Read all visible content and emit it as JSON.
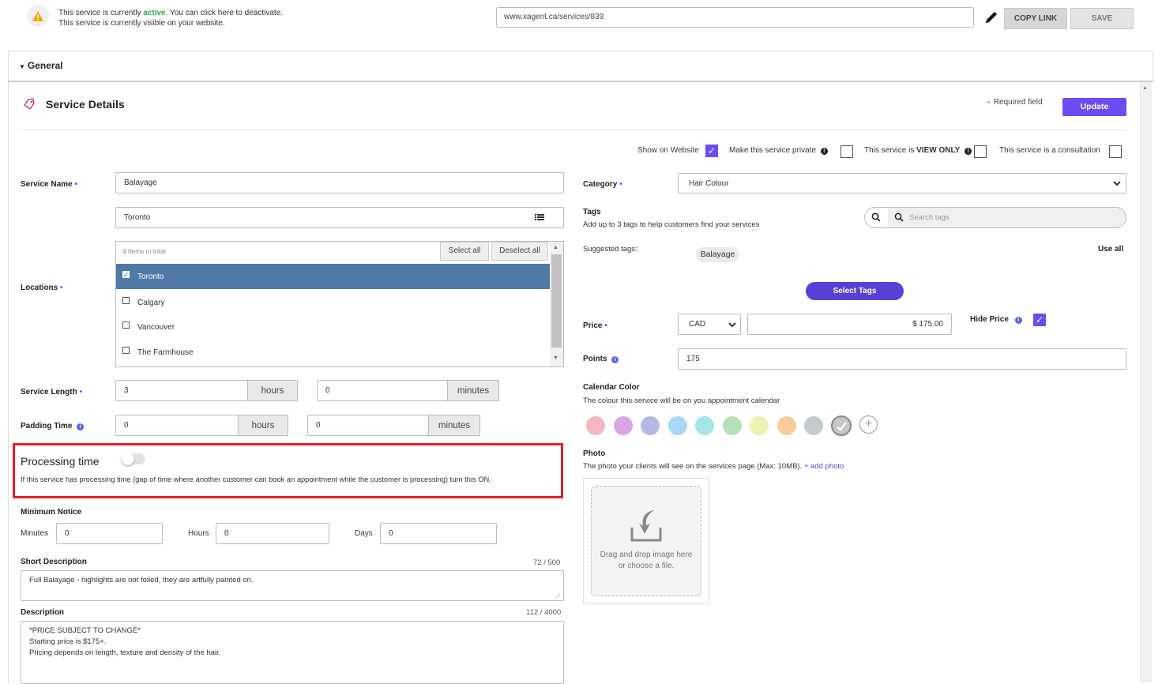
{
  "header": {
    "status_prefix": "This service is currently ",
    "status_word": "active",
    "status_suffix": ". You can click here to deactivate.",
    "visibility_line": "This service is currently visible on your website.",
    "url_value": "www.xagent.ca/services/839",
    "copy_link_label": "COPY LINK",
    "save_label": "SAVE"
  },
  "general": {
    "label": "General"
  },
  "details": {
    "title": "Service Details",
    "required_note": "Required field",
    "update_label": "Update",
    "flags": {
      "show_on_website": "Show on Website",
      "make_private": "Make this service private",
      "view_only_prefix": "This service is ",
      "view_only_bold": "VIEW ONLY",
      "consultation": "This service is a consultation"
    }
  },
  "form": {
    "service_name_label": "Service Name",
    "service_name_value": "Balayage",
    "location_selected": "Toronto",
    "locations_label": "Locations",
    "locations_total": "4 items in total",
    "select_all": "Select all",
    "deselect_all": "Deselect all",
    "locations": [
      "Toronto",
      "Calgary",
      "Vancouver",
      "The Farmhouse"
    ],
    "service_length_label": "Service Length",
    "length_hours": "3",
    "length_minutes": "0",
    "padding_label": "Padding Time",
    "padding_hours": "0",
    "padding_minutes": "0",
    "hours_unit": "hours",
    "minutes_unit": "minutes",
    "processing_title": "Processing time",
    "processing_text": "If this service has processing time (gap of time where another customer can book an appointment while the customer is processing) turn this ON.",
    "min_notice_label": "Minimum Notice",
    "minutes_label": "Minutes",
    "hours_label": "Hours",
    "days_label": "Days",
    "notice_minutes": "0",
    "notice_hours": "0",
    "notice_days": "0",
    "short_desc_label": "Short Description",
    "short_desc_count": "72 / 500",
    "short_desc_value": "Full Balayage - highlights are not foiled, they are artfully painted on.",
    "desc_label": "Description",
    "desc_count": "112 / 4000",
    "desc_lines": [
      "*PRICE SUBJECT TO CHANGE*",
      "Starting price is $175+.",
      "Pricing depends on length, texture and density of the hair."
    ]
  },
  "right": {
    "category_label": "Category",
    "category_value": "Hair Colour",
    "tags_label": "Tags",
    "tags_help": "Add up to 3 tags to help customers find your services",
    "search_placeholder": "Search tags",
    "suggested_label": "Suggested tags:",
    "suggested_tag": "Balayage",
    "use_all": "Use all",
    "select_tags_label": "Select Tags",
    "price_label": "Price",
    "currency": "CAD",
    "price_value": "$ 175.00",
    "hide_price_label": "Hide Price",
    "points_label": "Points",
    "points_value": "175",
    "calendar_label": "Calendar Color",
    "calendar_help": "The colour this service will be on you appointment calendar",
    "swatches": [
      "#f7b6c4",
      "#d7a6e3",
      "#b6b8e4",
      "#a9d8f5",
      "#a6e4e9",
      "#b6e0b8",
      "#eef2b5",
      "#f8cc9a",
      "#c5cbcc",
      "#c6c6c6"
    ],
    "photo_label": "Photo",
    "photo_help": "The photo your clients will see on the services page (Max: 10MB).",
    "add_photo": "+ add photo",
    "drop_line1": "Drag and drop image here",
    "drop_line2": "or choose a file."
  },
  "colors": {
    "accent": "#6c4cf5",
    "active": "#2aa84a",
    "highlight_border": "#e0222a",
    "selected_row": "#4f79a6"
  }
}
